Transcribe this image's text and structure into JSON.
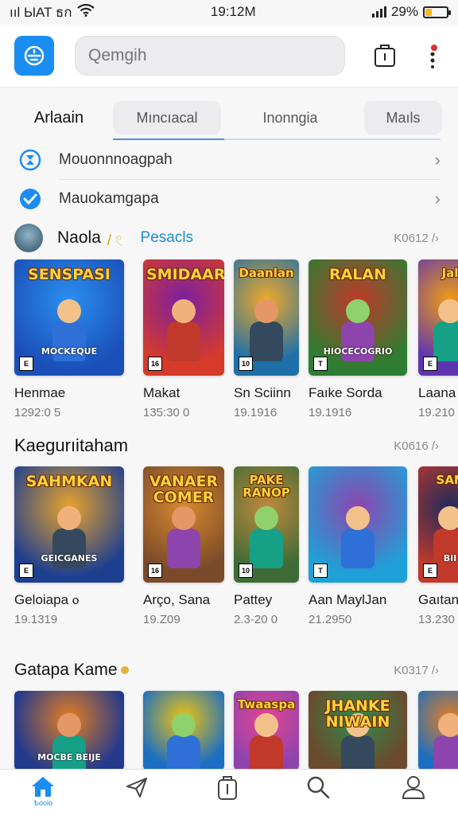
{
  "status_bar": {
    "carrier": "ııl ЫAT ธก",
    "time": "19:12M",
    "battery": "29%",
    "battery_level": 0.29
  },
  "header": {
    "search_placeholder": "Qemgih"
  },
  "tabs": [
    {
      "label": "Arlaain",
      "active": true
    },
    {
      "label": "Mıncıacal"
    },
    {
      "label": "Inonngia"
    },
    {
      "label": "Maıls"
    }
  ],
  "list_rows": [
    {
      "label": "Mouonnnoagpah"
    },
    {
      "label": "Mauokamgapa"
    }
  ],
  "sections": [
    {
      "title": "Naola",
      "tag": "/ 𓏲",
      "link": "Pesacls",
      "count": "K0612 /›",
      "cards": [
        {
          "cover_title": "SENSPASI",
          "cover_sub": "MOCKEQUE",
          "name": "Henmae",
          "meta": "1292:0 5"
        },
        {
          "cover_title": "SMIDAAR",
          "cover_sub": "",
          "name": "Makat",
          "meta": "135:30 0"
        },
        {
          "cover_title": "Daanlan",
          "cover_sub": "",
          "name": "Sn Sciinn",
          "meta": "19.1916"
        },
        {
          "cover_title": "RALAN",
          "cover_sub": "HIOCECOGRIO",
          "name": "Faıke Sorda",
          "meta": "19.1916"
        },
        {
          "cover_title": "Jal",
          "cover_sub": "",
          "name": "Laana",
          "meta": "19.210"
        }
      ]
    },
    {
      "title": "Kaegurıitaham",
      "count": "K0616 /›",
      "cards": [
        {
          "cover_title": "SAHMKAN",
          "cover_sub": "GEICGANES",
          "name": "Geloiapa ⲟ",
          "meta": "19.1319"
        },
        {
          "cover_title": "VANAER COMER",
          "cover_sub": "",
          "name": "Arço, Sana",
          "meta": "19.Z09"
        },
        {
          "cover_title": "PAKE RANOP",
          "cover_sub": "",
          "name": "Pattey",
          "meta": "2.3-20 0"
        },
        {
          "cover_title": "",
          "cover_sub": "",
          "name": "Aan MaylJan",
          "meta": "21.2950"
        },
        {
          "cover_title": "SAN",
          "cover_sub": "BII",
          "name": "Gaıtan",
          "meta": "13.230"
        }
      ]
    },
    {
      "title": "Gatapa Kame",
      "count": "K0317 /›",
      "cards": [
        {
          "cover_title": "",
          "cover_sub": "MOCBE BEIJE",
          "name": "",
          "meta": ""
        },
        {
          "cover_title": "",
          "cover_sub": "",
          "name": "",
          "meta": ""
        },
        {
          "cover_title": "Twaaspa",
          "cover_sub": "",
          "name": "",
          "meta": ""
        },
        {
          "cover_title": "JHANKE NIWAIN",
          "cover_sub": "",
          "name": "",
          "meta": ""
        },
        {
          "cover_title": "",
          "cover_sub": "",
          "name": "",
          "meta": ""
        }
      ]
    }
  ],
  "bottom_nav": {
    "items": [
      {
        "icon": "home-icon",
        "label": "Ѣoolo",
        "active": true
      },
      {
        "icon": "send-icon"
      },
      {
        "icon": "library-icon"
      },
      {
        "icon": "search-icon"
      },
      {
        "icon": "profile-icon"
      }
    ]
  },
  "colors": {
    "accent": "#1a8df0",
    "link": "#1a8fd6",
    "notification": "#e02d2d",
    "battery": "#f2b71f"
  }
}
